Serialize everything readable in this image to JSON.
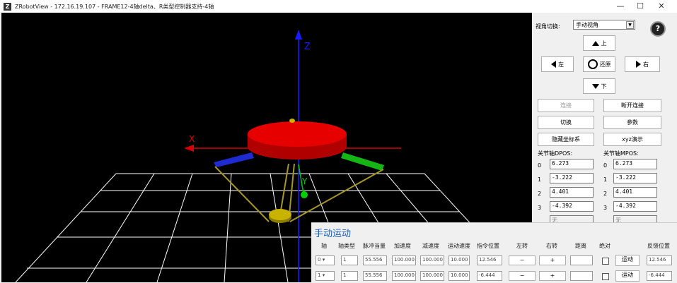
{
  "window": {
    "title": "ZRobotView - 172.16.19.107 - FRAME12-4轴delta、R类型控制器支持-4轴",
    "app_icon": "Z",
    "minimize": "—",
    "maximize": "☐",
    "close": "✕"
  },
  "viewport": {
    "axis_x_label": "X",
    "axis_y_label": "Y",
    "axis_z_label": "Z",
    "colors": {
      "x_axis": "#d40000",
      "y_axis": "#00c800",
      "z_axis": "#1a1aff",
      "platform": "#e60000",
      "effector": "#c8b400",
      "grid": "#ffffff"
    }
  },
  "panel": {
    "view_switch_label": "视角切换:",
    "view_select_value": "手动视角",
    "help_icon": "?",
    "nav": {
      "up": "上",
      "left": "左",
      "reset": "还原",
      "right": "右",
      "down": "下"
    },
    "buttons": {
      "connect": "连接",
      "disconnect": "断开连接",
      "switch": "切换",
      "params": "参数",
      "hide_coords": "隐藏坐标系",
      "xyz_demo": "xyz演示"
    },
    "dpos_label": "关节轴DPOS:",
    "mpos_label": "关节轴MPOS:",
    "dpos": [
      {
        "idx": "0",
        "value": "6.273"
      },
      {
        "idx": "1",
        "value": "-3.222"
      },
      {
        "idx": "2",
        "value": "4.401"
      },
      {
        "idx": "3",
        "value": "-4.392"
      }
    ],
    "mpos": [
      {
        "idx": "0",
        "value": "6.273"
      },
      {
        "idx": "1",
        "value": "-3.222"
      },
      {
        "idx": "2",
        "value": "4.401"
      },
      {
        "idx": "3",
        "value": "-4.392"
      }
    ],
    "partial_field_value": "无"
  },
  "manual": {
    "title": "手动运动",
    "headers": [
      "轴",
      "轴类型",
      "脉冲当量",
      "加速度",
      "减速度",
      "运动速度",
      "指令位置",
      "左转",
      "右转",
      "距离",
      "绝对",
      "",
      "反馈位置"
    ],
    "rows": [
      {
        "axis": "0",
        "type": "1",
        "units": "55.556",
        "accel": "100.000",
        "decel": "100.000",
        "speed": "10.000",
        "cmd_pos": "12.546",
        "left": "−",
        "right": "+",
        "distance": "",
        "move": "运动",
        "feedback": "12.546"
      },
      {
        "axis": "1",
        "type": "1",
        "units": "55.556",
        "accel": "100.000",
        "decel": "100.000",
        "speed": "10.000",
        "cmd_pos": "-6.444",
        "left": "−",
        "right": "+",
        "distance": "",
        "move": "运动",
        "feedback": "-6.444"
      }
    ]
  }
}
